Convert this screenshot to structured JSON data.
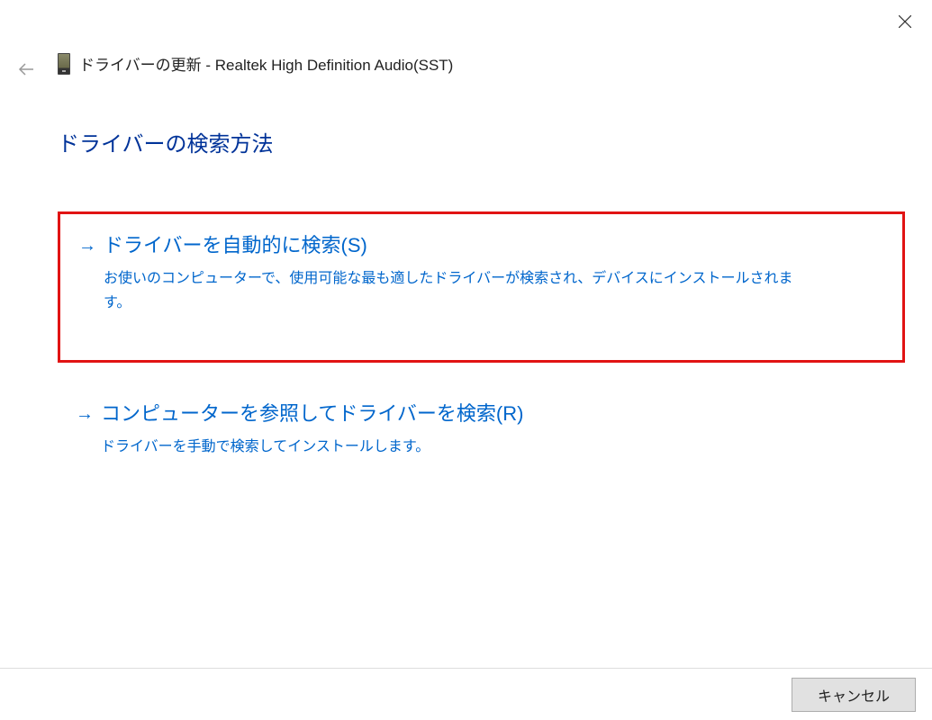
{
  "window": {
    "title": "ドライバーの更新 - Realtek High Definition Audio(SST)"
  },
  "heading": "ドライバーの検索方法",
  "options": [
    {
      "title": "ドライバーを自動的に検索(S)",
      "description": "お使いのコンピューターで、使用可能な最も適したドライバーが検索され、デバイスにインストールされます。",
      "highlighted": true
    },
    {
      "title": "コンピューターを参照してドライバーを検索(R)",
      "description": "ドライバーを手動で検索してインストールします。",
      "highlighted": false
    }
  ],
  "footer": {
    "cancel": "キャンセル"
  }
}
